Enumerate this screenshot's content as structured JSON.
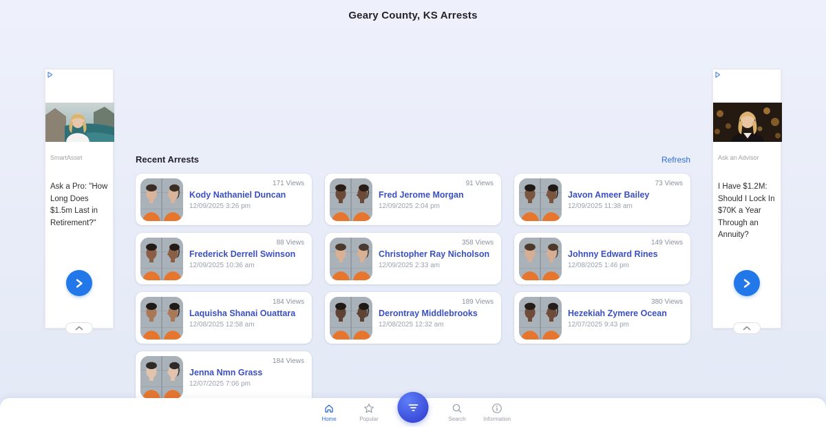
{
  "page": {
    "title": "Geary County, KS Arrests"
  },
  "recent": {
    "heading": "Recent Arrests",
    "refresh_label": "Refresh"
  },
  "arrests": [
    {
      "name": "Kody Nathaniel Duncan",
      "date": "12/09/2025 3:26 pm",
      "views": "171 Views",
      "skin": "#d9b49a",
      "hair": "#3a2e26"
    },
    {
      "name": "Fred Jerome Morgan",
      "date": "12/09/2025 2:04 pm",
      "views": "91 Views",
      "skin": "#6b4a38",
      "hair": "#2a1d18"
    },
    {
      "name": "Javon Ameer Bailey",
      "date": "12/09/2025 11:38 am",
      "views": "73 Views",
      "skin": "#7a553f",
      "hair": "#1f1a16"
    },
    {
      "name": "Frederick Derrell Swinson",
      "date": "12/09/2025 10:36 am",
      "views": "88 Views",
      "skin": "#8a5f46",
      "hair": "#241c18"
    },
    {
      "name": "Christopher Ray Nicholson",
      "date": "12/09/2025 2:33 am",
      "views": "358 Views",
      "skin": "#d8b094",
      "hair": "#4a3b30"
    },
    {
      "name": "Johnny Edward Rines",
      "date": "12/08/2025 1:46 pm",
      "views": "149 Views",
      "skin": "#d5ae93",
      "hair": "#4e3a2c"
    },
    {
      "name": "Laquisha Shanai Ouattara",
      "date": "12/08/2025 12:58 am",
      "views": "184 Views",
      "skin": "#a97856",
      "hair": "#1e1a18"
    },
    {
      "name": "Derontray Middlebrooks",
      "date": "12/08/2025 12:32 am",
      "views": "189 Views",
      "skin": "#5f4434",
      "hair": "#201a16"
    },
    {
      "name": "Hezekiah Zymere Ocean",
      "date": "12/07/2025 9:43 pm",
      "views": "380 Views",
      "skin": "#6e4c39",
      "hair": "#241d18"
    },
    {
      "name": "Jenna Nmn Grass",
      "date": "12/07/2025 7:06 pm",
      "views": "184 Views",
      "skin": "#e2c3ad",
      "hair": "#2e2a28"
    }
  ],
  "ads": {
    "left": {
      "brand": "SmartAsset",
      "headline": "Ask a Pro: \"How Long Does $1.5m Last in Retirement?\""
    },
    "right": {
      "brand": "Ask an Advisor",
      "headline": "I Have $1.2M: Should I Lock In $70K a Year Through an Annuity?"
    }
  },
  "bottom_nav": {
    "home": "Home",
    "popular": "Popular",
    "search": "Search",
    "information": "Information"
  },
  "colors": {
    "accent_blue": "#2278e8",
    "name_blue": "#3b50c0",
    "nav_active": "#2f6bd8",
    "jumpsuit_orange": "#e6762e"
  }
}
